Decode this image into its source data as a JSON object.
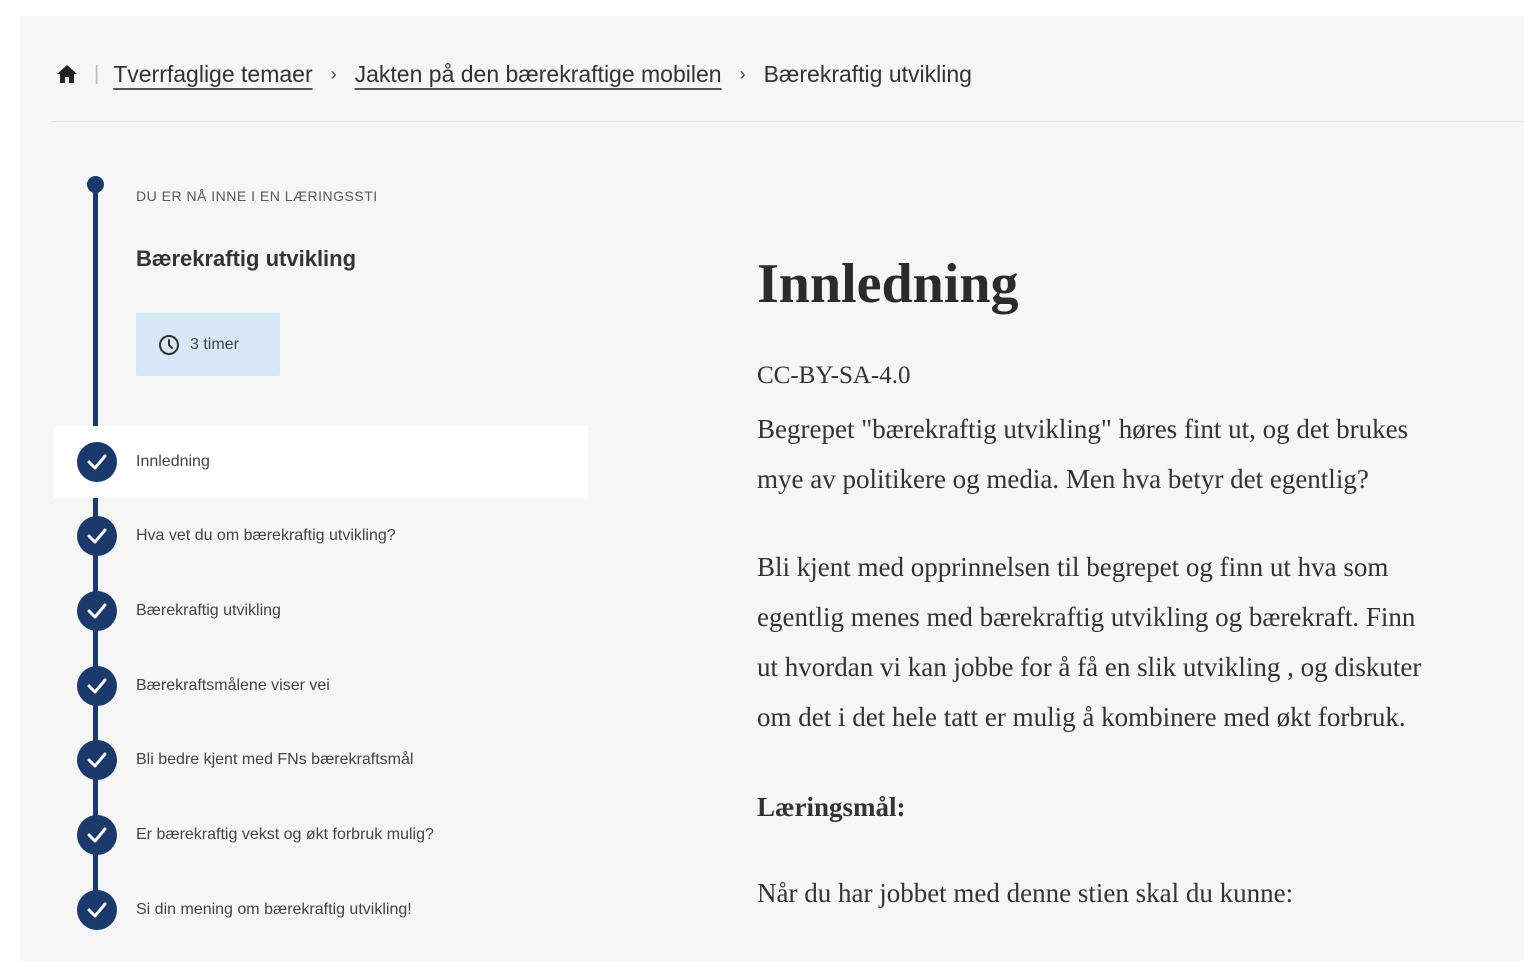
{
  "breadcrumb": {
    "home_icon": "home-icon",
    "items": [
      {
        "label": "Tverrfaglige temaer"
      },
      {
        "label": "Jakten på den bærekraftige mobilen"
      }
    ],
    "current": "Bærekraftig utvikling"
  },
  "learning_path": {
    "overline": "DU ER NÅ INNE I EN LÆRINGSSTI",
    "title": "Bærekraftig utvikling",
    "duration": {
      "icon": "clock-icon",
      "label": "3 timer"
    },
    "steps": [
      {
        "label": "Innledning",
        "completed": true,
        "active": true
      },
      {
        "label": "Hva vet du om bærekraftig utvikling?",
        "completed": true,
        "active": false
      },
      {
        "label": "Bærekraftig utvikling",
        "completed": true,
        "active": false
      },
      {
        "label": "Bærekraftsmålene viser vei",
        "completed": true,
        "active": false
      },
      {
        "label": "Bli bedre kjent med FNs bærekraftsmål",
        "completed": true,
        "active": false
      },
      {
        "label": "Er bærekraftig vekst og økt forbruk mulig?",
        "completed": true,
        "active": false
      },
      {
        "label": "Si din mening om bærekraftig utvikling!",
        "completed": true,
        "active": false
      }
    ],
    "accent_color": "#1b3a6b"
  },
  "article": {
    "title": "Innledning",
    "license": "CC-BY-SA-4.0",
    "paragraph1": [
      "Begrepet \"bærekraftig utvikling\" høres fint ut, og det brukes",
      "mye av politikere og media. Men hva betyr det egentlig?"
    ],
    "paragraph2": [
      "Bli kjent med opprinnelsen til begrepet og finn ut hva som",
      "egentlig menes med bærekraftig utvikling og bærekraft. Finn",
      "ut hvordan vi kan jobbe for å få en slik utvikling , og diskuter",
      "om det i det hele tatt er mulig å kombinere med økt forbruk."
    ],
    "goals_heading": "Læringsmål:",
    "goals_intro": "Når du har jobbet med denne stien skal du kunne:"
  }
}
